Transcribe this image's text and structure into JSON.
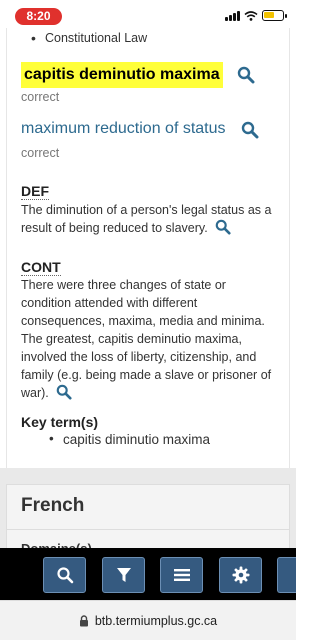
{
  "status_bar": {
    "time": "8:20"
  },
  "previous_section": {
    "bullet": "Constitutional Law"
  },
  "latin": {
    "term": "capitis deminutio maxima",
    "term_status": "correct"
  },
  "english": {
    "term": "maximum reduction of status",
    "term_status": "correct"
  },
  "def": {
    "heading": "DEF",
    "line1": "The diminution of a person's legal status as a",
    "line2": "result of being reduced to slavery."
  },
  "cont": {
    "heading": "CONT",
    "lines": [
      "There were three changes of state or",
      "condition attended with different",
      "consequences, maxima, media and minima.",
      "The greatest, capitis deminutio maxima,",
      "involved the loss of liberty, citizenship, and",
      "family (e.g. being made a slave or prisoner of",
      "war)."
    ]
  },
  "key_terms": {
    "heading": "Key term(s)",
    "items": [
      "capitis diminutio maxima"
    ]
  },
  "french": {
    "title": "French",
    "domaine_label": "Domaine(s)"
  },
  "toolbar": {
    "buttons": [
      "search-icon",
      "filter-icon",
      "menu-icon",
      "gear-icon",
      "more-icon"
    ]
  },
  "browser": {
    "url": "btb.termiumplus.gc.ca"
  },
  "colors": {
    "highlight": "#ffff3a",
    "link": "#2d6a8f",
    "toolbar_button": "#355a80",
    "time_pill": "#e0312d"
  }
}
